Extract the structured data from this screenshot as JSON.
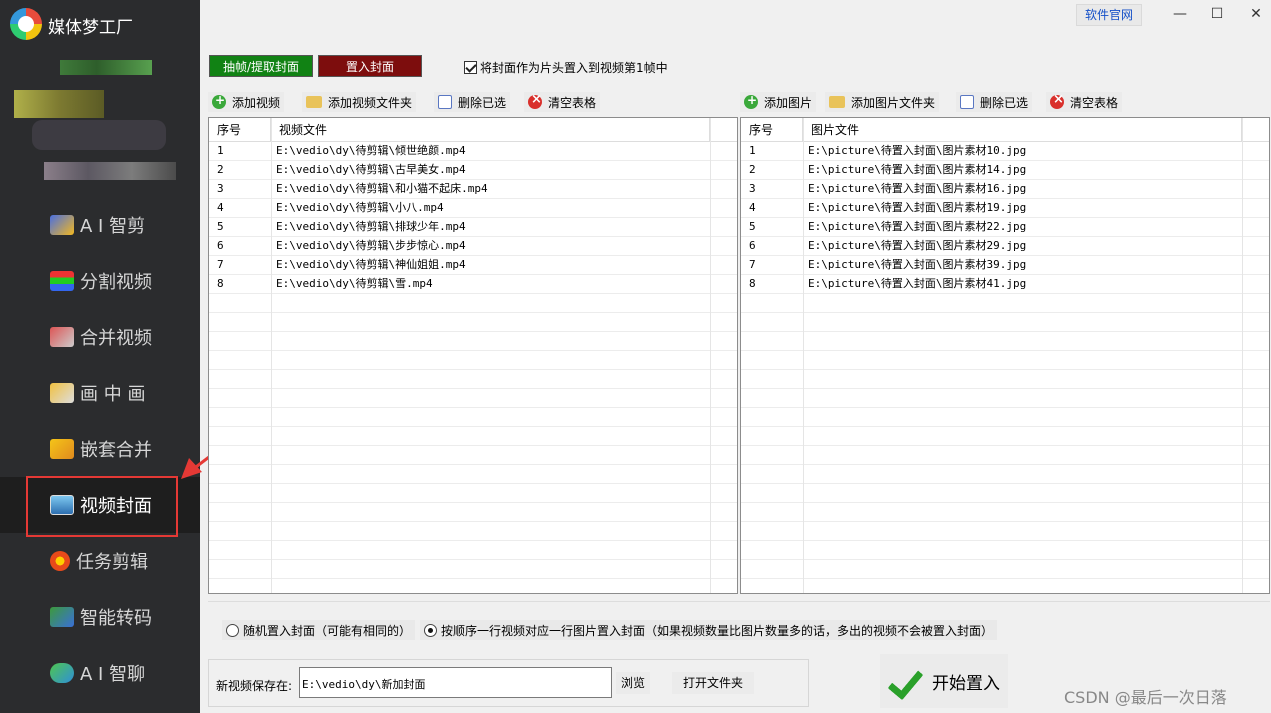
{
  "app": {
    "title": "媒体梦工厂"
  },
  "window": {
    "site_link": "软件官网",
    "minimize": "—",
    "maximize": "☐",
    "close": "✕"
  },
  "sidebar": {
    "items": [
      {
        "label": "A I 智剪",
        "icon": "ai-cut-icon"
      },
      {
        "label": "分割视频",
        "icon": "split-video-icon"
      },
      {
        "label": "合并视频",
        "icon": "merge-video-icon"
      },
      {
        "label": "画 中 画",
        "icon": "pip-icon"
      },
      {
        "label": "嵌套合并",
        "icon": "nested-merge-icon"
      },
      {
        "label": "视频封面",
        "icon": "video-cover-icon",
        "active": true
      },
      {
        "label": "任务剪辑",
        "icon": "task-edit-icon"
      },
      {
        "label": "智能转码",
        "icon": "transcode-icon"
      },
      {
        "label": "A I 智聊",
        "icon": "ai-chat-icon"
      }
    ]
  },
  "top": {
    "extract_button": "抽帧/提取封面",
    "insert_button": "置入封面",
    "checkbox_label": "将封面作为片头置入到视频第1帧中"
  },
  "video_panel": {
    "add_video": "添加视频",
    "add_folder": "添加视频文件夹",
    "delete_selected": "删除已选",
    "clear_table": "清空表格",
    "columns": [
      "序号",
      "视频文件"
    ],
    "rows": [
      [
        "1",
        "E:\\vedio\\dy\\待剪辑\\倾世绝颜.mp4"
      ],
      [
        "2",
        "E:\\vedio\\dy\\待剪辑\\古早美女.mp4"
      ],
      [
        "3",
        "E:\\vedio\\dy\\待剪辑\\和小猫不起床.mp4"
      ],
      [
        "4",
        "E:\\vedio\\dy\\待剪辑\\小八.mp4"
      ],
      [
        "5",
        "E:\\vedio\\dy\\待剪辑\\排球少年.mp4"
      ],
      [
        "6",
        "E:\\vedio\\dy\\待剪辑\\步步惊心.mp4"
      ],
      [
        "7",
        "E:\\vedio\\dy\\待剪辑\\神仙姐姐.mp4"
      ],
      [
        "8",
        "E:\\vedio\\dy\\待剪辑\\雪.mp4"
      ]
    ]
  },
  "image_panel": {
    "add_image": "添加图片",
    "add_folder": "添加图片文件夹",
    "delete_selected": "删除已选",
    "clear_table": "清空表格",
    "columns": [
      "序号",
      "图片文件"
    ],
    "rows": [
      [
        "1",
        "E:\\picture\\待置入封面\\图片素材10.jpg"
      ],
      [
        "2",
        "E:\\picture\\待置入封面\\图片素材14.jpg"
      ],
      [
        "3",
        "E:\\picture\\待置入封面\\图片素材16.jpg"
      ],
      [
        "4",
        "E:\\picture\\待置入封面\\图片素材19.jpg"
      ],
      [
        "5",
        "E:\\picture\\待置入封面\\图片素材22.jpg"
      ],
      [
        "6",
        "E:\\picture\\待置入封面\\图片素材29.jpg"
      ],
      [
        "7",
        "E:\\picture\\待置入封面\\图片素材39.jpg"
      ],
      [
        "8",
        "E:\\picture\\待置入封面\\图片素材41.jpg"
      ]
    ]
  },
  "mode": {
    "random_label": "随机置入封面（可能有相同的）",
    "sequential_label": "按顺序一行视频对应一行图片置入封面（如果视频数量比图片数量多的话，多出的视频不会被置入封面）",
    "selected": "sequential"
  },
  "output": {
    "label": "新视频保存在:",
    "path": "E:\\vedio\\dy\\新加封面",
    "browse": "浏览",
    "open_folder": "打开文件夹",
    "start": "开始置入"
  },
  "watermark": "CSDN @最后一次日落",
  "colors": {
    "sidebar_bg": "#2b2c2e",
    "green_button": "#118214",
    "red_button": "#7d0d0d",
    "highlight_red": "#e53935"
  }
}
